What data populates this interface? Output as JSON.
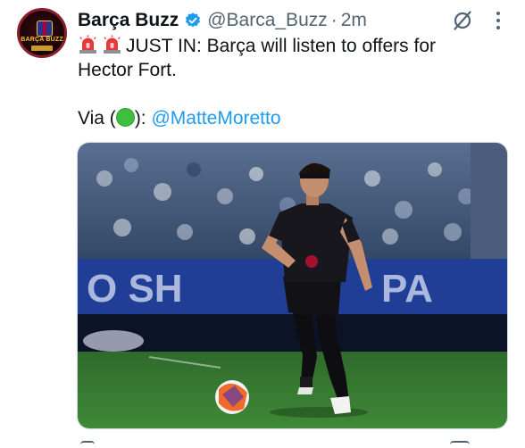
{
  "author": {
    "display_name": "Barça Buzz",
    "handle": "@Barca_Buzz",
    "separator": "·",
    "time": "2m",
    "avatar_text": "BARÇA BUZZ"
  },
  "tweet": {
    "line1": "JUST IN: Barça will listen to offers for",
    "line2": "Hector Fort.",
    "via_prefix": "Via (",
    "via_suffix": "):",
    "mention": "@MatteMoretto"
  },
  "colors": {
    "link": "#1d9bf0",
    "verified": "#1d9bf0",
    "secondary_text": "#536471"
  },
  "icons": [
    "verified-icon",
    "grok-icon",
    "more-icon",
    "siren-icon",
    "green-circle-icon"
  ]
}
